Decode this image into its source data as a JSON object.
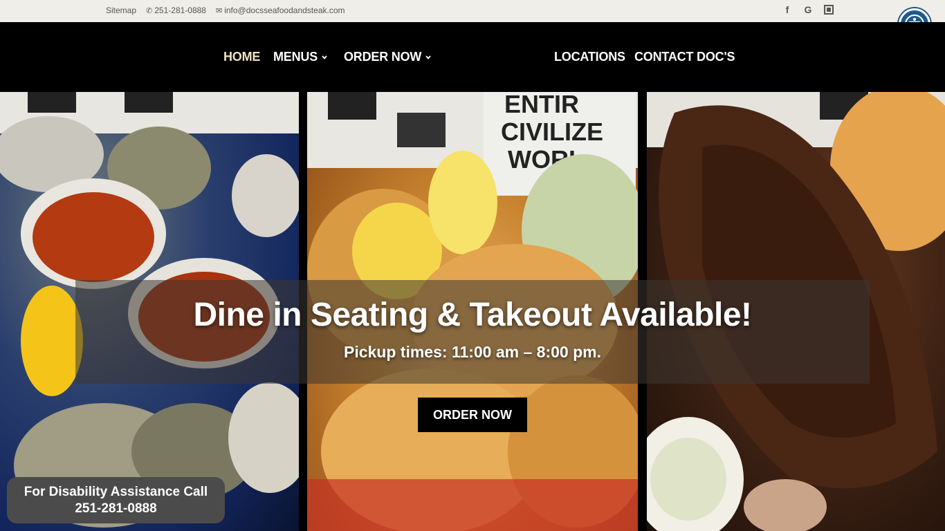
{
  "topbar": {
    "sitemap": "Sitemap",
    "phone": "251-281-0888",
    "email": "info@docsseafoodandsteak.com",
    "icons": [
      "phone-icon",
      "mail-icon"
    ],
    "social": [
      "facebook-icon",
      "google-icon",
      "google-my-business-icon"
    ]
  },
  "nav": {
    "items": [
      {
        "label": "HOME",
        "active": true
      },
      {
        "label": "MENUS",
        "dropdown": true
      },
      {
        "label": "ORDER NOW",
        "dropdown": true
      },
      {
        "label": "LOCATIONS"
      },
      {
        "label": "CONTACT DOC'S"
      }
    ]
  },
  "hero": {
    "headline": "Dine in Seating & Takeout Available!",
    "subline": "Pickup times: 11:00 am – 8:00 pm.",
    "cta": "ORDER NOW",
    "panels": [
      "oysters-photo",
      "fried-seafood-photo",
      "steak-photo"
    ]
  },
  "disability": {
    "line1": "For Disability Assistance Call",
    "line2": "251-281-0888"
  },
  "colors": {
    "topbar_bg": "#efeee8",
    "nav_bg": "#000000",
    "active_nav": "#f0e3c4",
    "access_blue": "#1d5a8c"
  }
}
